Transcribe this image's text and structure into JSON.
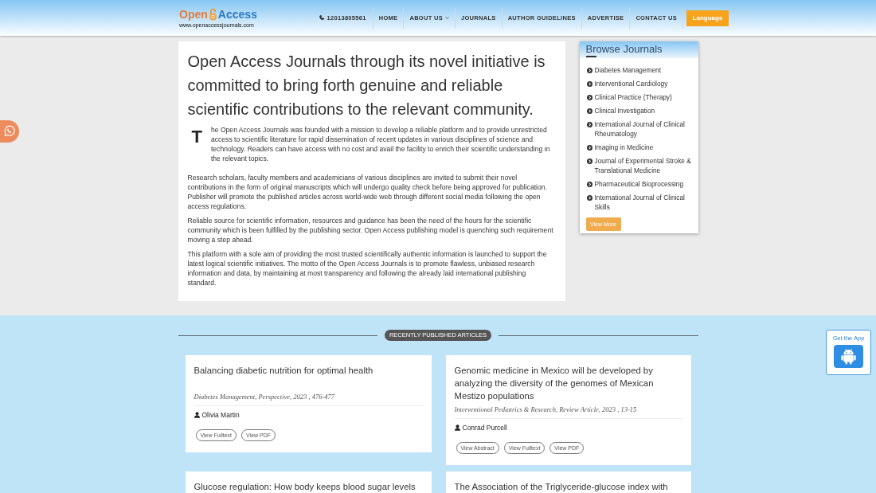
{
  "header": {
    "logo": {
      "first_word": "Open",
      "second_word": "Access",
      "url": "www.openaccessjournals.com"
    },
    "phone": "12013805561",
    "nav": [
      {
        "label": "HOME",
        "has_dropdown": false
      },
      {
        "label": "ABOUT US",
        "has_dropdown": true
      },
      {
        "label": "JOURNALS",
        "has_dropdown": false
      },
      {
        "label": "AUTHOR GUIDELINES",
        "has_dropdown": false
      },
      {
        "label": "ADVERTISE",
        "has_dropdown": false
      },
      {
        "label": "CONTACT US",
        "has_dropdown": false
      }
    ],
    "language_button": "Language"
  },
  "intro": {
    "heading": "Open Access Journals through its novel initiative is committed to bring forth genuine and reliable scientific contributions to the relevant community.",
    "paragraphs": [
      {
        "drop_cap": "T",
        "text": "he Open Access Journals was founded with a mission to develop a reliable platform and to provide unrestricted access to scientific literature for rapid dissemination of recent updates in various disciplines of science and technology. Readers can have access with no cost and avail the facility to enrich their scientific understanding in the relevant topics."
      },
      {
        "text": "Research scholars, faculty members and academicians of various disciplines are invited to submit their novel contributions in the form of original manuscripts which will undergo quality check before being approved for publication. Publisher will promote the published articles across world-wide web through different social media following the open access regulations."
      },
      {
        "text": "Reliable source for scientific information, resources and guidance has been the need of the hours for the scientific community which is been fulfilled by the publishing sector. Open Access publishing model is quenching such requirement moving a step ahead."
      },
      {
        "text": "This platform with a sole aim of providing the most trusted scientifically authentic information is launched to support the latest logical scientific initiatives. The motto of the Open Access Journals is to promote flawless, unbiased research information and data, by maintaining at most transparency and following the already laid international publishing standard."
      }
    ]
  },
  "browse_journals": {
    "title": "Browse Journals",
    "items": [
      "Diabetes Management",
      "Interventional Cardiology",
      "Clinical Practice (Therapy)",
      "Clinical Investigation",
      "International Journal of Clinical Rheumatology",
      "Imaging in Medicine",
      "Journal of Experimental Stroke & Translational Medicine",
      "Pharmaceutical Bioprocessing",
      "International Journal of Clinical Skills"
    ],
    "button": "View More"
  },
  "recent_articles": {
    "title": "RECENTLY PUBLISHED ARTICLES",
    "articles": [
      {
        "title": "Balancing diabetic nutrition for optimal health",
        "citation": "Diabetes Management, Perspective, 2023 , 476-477",
        "author": "Olivia Martin",
        "links": [
          "View Fulltext",
          "View PDF"
        ]
      },
      {
        "title": "Genomic medicine in Mexico will be developed by analyzing the diversity of the genomes of Mexican Mestizo populations",
        "citation": "Interventional Pediatrics & Research, Review Article, 2023 , 13-15",
        "author": "Conrad Purcell",
        "links": [
          "View Abstract",
          "View Fulltext",
          "View PDF"
        ]
      },
      {
        "title": "Glucose regulation: How body keeps blood sugar levels"
      },
      {
        "title": "The Association of the Triglyceride-glucose index with"
      }
    ]
  },
  "app_widget": {
    "label": "Get the App"
  }
}
